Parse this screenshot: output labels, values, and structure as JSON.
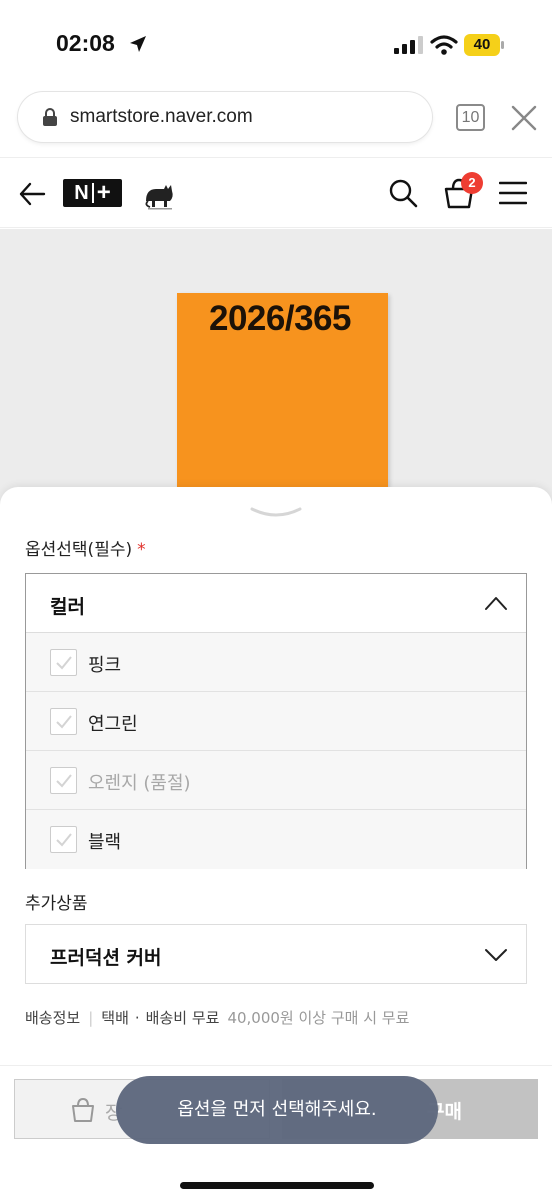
{
  "status_bar": {
    "time": "02:08",
    "battery": "40"
  },
  "browser": {
    "url": "smartstore.naver.com",
    "tab_count": "10"
  },
  "header": {
    "logo_n": "N",
    "logo_plus": "+",
    "cart_badge": "2"
  },
  "product": {
    "cover_text": "2026/365",
    "cover_color": "#f7931e"
  },
  "options": {
    "section_label": "옵션선택(필수)",
    "required_mark": "*",
    "dropdown_label": "컬러",
    "items": [
      {
        "label": "핑크",
        "sold_out": false
      },
      {
        "label": "연그린",
        "sold_out": false
      },
      {
        "label": "오렌지 (품절)",
        "sold_out": true
      },
      {
        "label": "블랙",
        "sold_out": false
      }
    ]
  },
  "addons": {
    "section_label": "추가상품",
    "dropdown_label": "프러덕션 커버"
  },
  "shipping": {
    "label": "배송정보",
    "method": "택배",
    "fee": "배송비 무료",
    "condition": "40,000원 이상 구매 시 무료"
  },
  "actions": {
    "cart_label": "장",
    "buy_label": "구매"
  },
  "toast": {
    "message": "옵션을 먼저 선택해주세요."
  },
  "colors": {
    "accent_red": "#ee3d32",
    "toast_bg": "#5d677d"
  }
}
